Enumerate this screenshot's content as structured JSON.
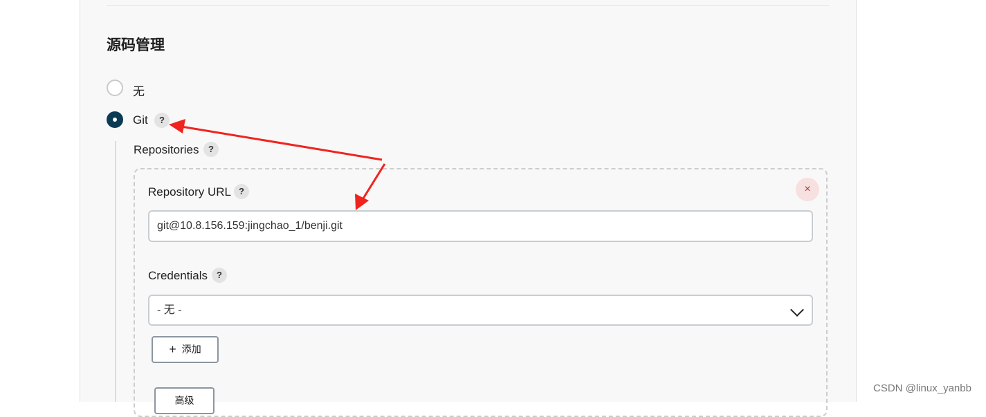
{
  "section": {
    "title": "源码管理"
  },
  "scm_options": [
    {
      "label": "无",
      "selected": false
    },
    {
      "label": "Git",
      "selected": true
    }
  ],
  "help_glyph": "?",
  "git": {
    "repositories_label": "Repositories",
    "repository_url_label": "Repository URL",
    "repository_url_value": "git@10.8.156.159:jingchao_1/benji.git",
    "credentials_label": "Credentials",
    "credentials_selected": "- 无 -",
    "add_button": {
      "icon": "+",
      "label": "添加"
    },
    "advanced_button_label": "高级"
  },
  "remove_icon": "×",
  "annotation_color": "#f0231e",
  "watermark": "CSDN @linux_yanbb"
}
